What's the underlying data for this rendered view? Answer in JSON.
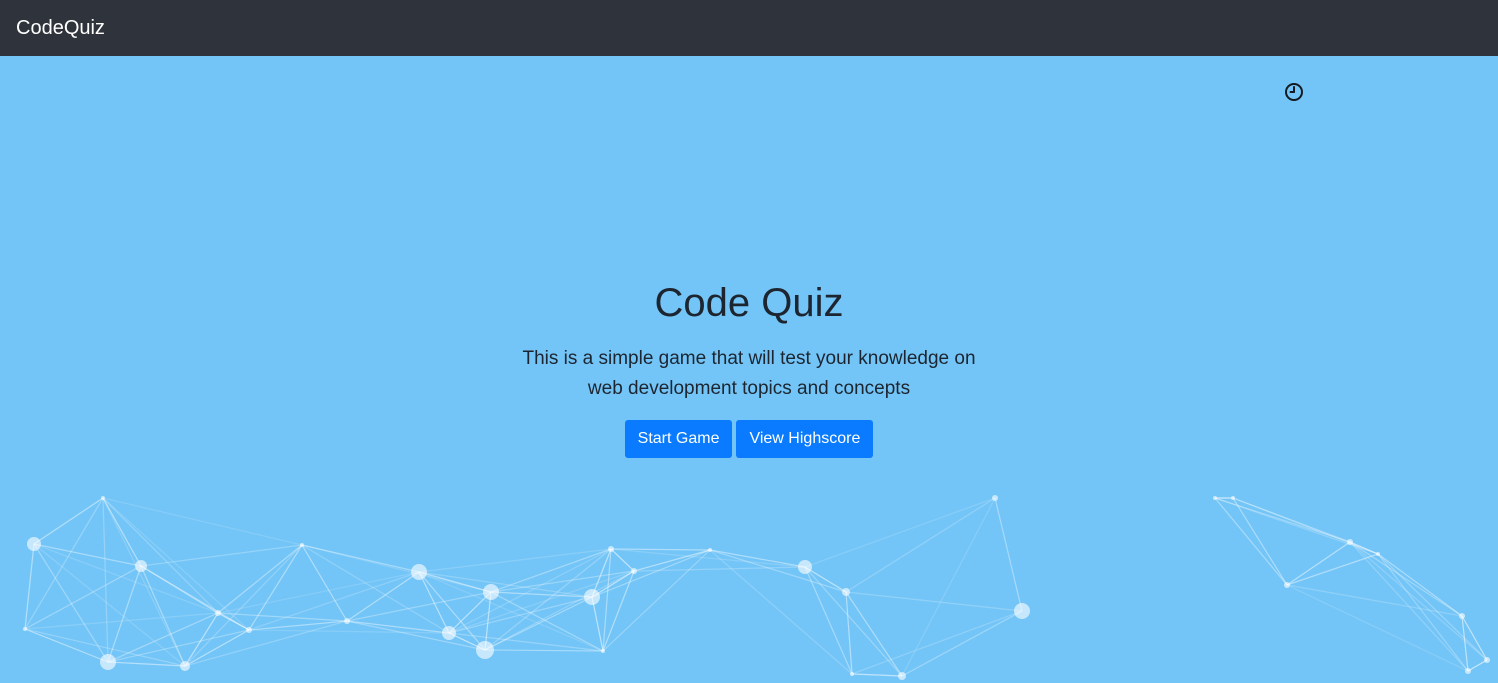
{
  "navbar": {
    "brand": "CodeQuiz"
  },
  "timer": {
    "icon": "clock-icon",
    "value": ""
  },
  "hero": {
    "title": "Code Quiz",
    "description": "This is a simple game that will test your knowledge on web development topics and concepts",
    "start_button": "Start Game",
    "highscore_button": "View Highscore"
  },
  "colors": {
    "navbar_bg": "#2f333b",
    "page_bg": "#74c5f7",
    "button_bg": "#0a7bff",
    "text": "#1c2530"
  }
}
